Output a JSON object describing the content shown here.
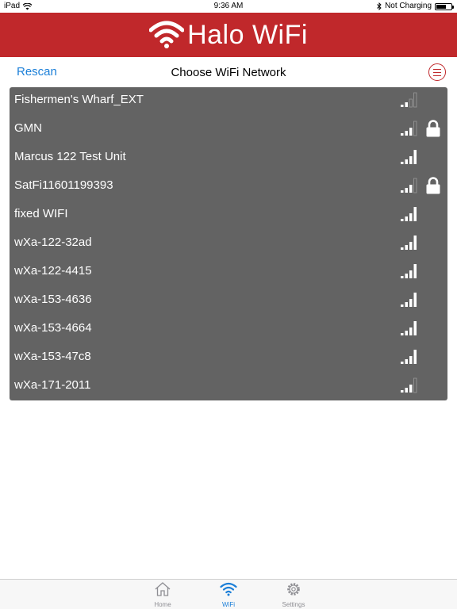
{
  "status_bar": {
    "device": "iPad",
    "time": "9:36 AM",
    "charging": "Not Charging"
  },
  "header": {
    "title": "Halo WiFi",
    "color": "#c0282b"
  },
  "nav": {
    "rescan_label": "Rescan",
    "title": "Choose WiFi Network",
    "menu_icon": "menu-icon"
  },
  "networks": [
    {
      "name": "Fishermen's Wharf_EXT",
      "signal_bars": 2,
      "locked": false
    },
    {
      "name": "GMN",
      "signal_bars": 3,
      "locked": true
    },
    {
      "name": "Marcus 122 Test Unit",
      "signal_bars": 4,
      "locked": false
    },
    {
      "name": "SatFi11601199393",
      "signal_bars": 3,
      "locked": true
    },
    {
      "name": "fixed WIFI",
      "signal_bars": 4,
      "locked": false
    },
    {
      "name": "wXa-122-32ad",
      "signal_bars": 4,
      "locked": false
    },
    {
      "name": "wXa-122-4415",
      "signal_bars": 4,
      "locked": false
    },
    {
      "name": "wXa-153-4636",
      "signal_bars": 4,
      "locked": false
    },
    {
      "name": "wXa-153-4664",
      "signal_bars": 4,
      "locked": false
    },
    {
      "name": "wXa-153-47c8",
      "signal_bars": 4,
      "locked": false
    },
    {
      "name": "wXa-171-2011",
      "signal_bars": 3,
      "locked": false
    }
  ],
  "tabs": [
    {
      "label": "Home",
      "icon": "home-icon",
      "active": false
    },
    {
      "label": "WiFi",
      "icon": "wifi-icon",
      "active": true
    },
    {
      "label": "Settings",
      "icon": "gear-icon",
      "active": false
    }
  ],
  "colors": {
    "accent_red": "#c0282b",
    "link_blue": "#1b7fd8",
    "list_bg": "#636363",
    "tab_active": "#1b7fd8",
    "tab_inactive": "#8e8e93"
  }
}
